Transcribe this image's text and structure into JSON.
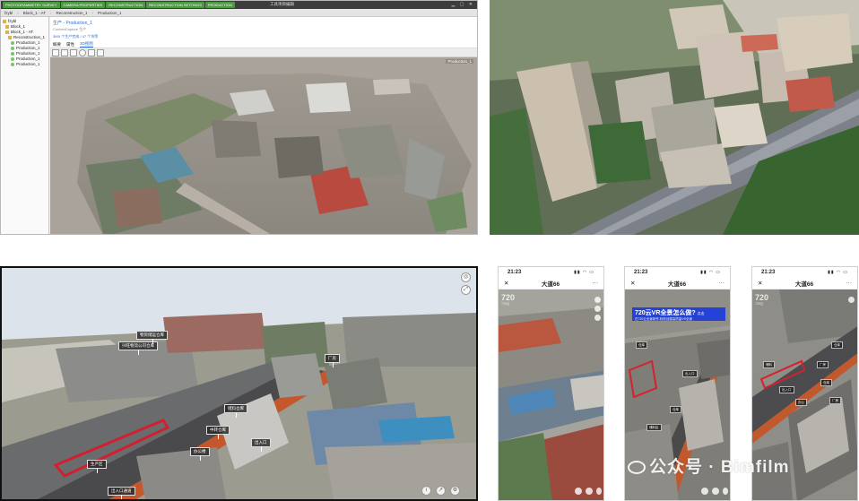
{
  "desktop_app": {
    "window_title": "工具项目编辑",
    "ribbon_tabs": [
      "PHOTOGRAMMETRY SURVEY",
      "CAMERA PROPERTIES",
      "RECONSTRUCTION",
      "RECONSTRUCTION SETTINGS",
      "PRODUCTION"
    ],
    "breadcrumbs": [
      "fzybl",
      "Block_1 - AT",
      "Reconstruction_1",
      "Production_1"
    ],
    "tree": [
      {
        "label": "fzybl",
        "type": "project"
      },
      {
        "label": "Block_1",
        "type": "block"
      },
      {
        "label": "Block_1 - AT",
        "type": "block"
      },
      {
        "label": "Reconstruction_1",
        "type": "recon"
      },
      {
        "label": "Production_1",
        "type": "prod"
      },
      {
        "label": "Production_1",
        "type": "prod"
      },
      {
        "label": "Production_1",
        "type": "prod"
      },
      {
        "label": "Production_1",
        "type": "prod"
      },
      {
        "label": "Production_1",
        "type": "prod"
      }
    ],
    "production_title": "生产 - Production_1",
    "production_subtitle": "ContextCapture 生产",
    "production_stat": "3MX 个生产完成 / 47 个块等",
    "subtabs": [
      "概要",
      "属性",
      "3D视图"
    ],
    "active_subtab": "3D视图",
    "viewport_label": "Production_1"
  },
  "scene_3d": {
    "tags": [
      "兴旺物流公司仓库",
      "物资储运仓库",
      "厂房",
      "储料仓库",
      "中转仓库",
      "出入口",
      "生产区",
      "办公楼",
      "出入口通道"
    ]
  },
  "phones": [
    {
      "time": "21:23",
      "title": "大道66",
      "close": "✕",
      "more": "···",
      "vr_badge": "720",
      "vr_sub": "720云",
      "banner": null,
      "tags": []
    },
    {
      "time": "21:23",
      "title": "大道66",
      "close": "✕",
      "more": "···",
      "vr_badge": "",
      "vr_sub": "",
      "banner": {
        "title": "720云VR全景怎么做?",
        "arrow": "点击",
        "sub": "在720云全景制作,轻松创建高质量VR全景"
      },
      "tags": [
        "仓库",
        "出入口",
        "仓库",
        "储料区"
      ]
    },
    {
      "time": "21:23",
      "title": "大道66",
      "close": "✕",
      "more": "···",
      "vr_badge": "720",
      "vr_sub": "720云",
      "banner": null,
      "tags": [
        "仓库",
        "储料",
        "厂房",
        "出入口",
        "仓库",
        "办公",
        "厂房"
      ]
    }
  ],
  "watermark": "公众号 · Bimfilm"
}
